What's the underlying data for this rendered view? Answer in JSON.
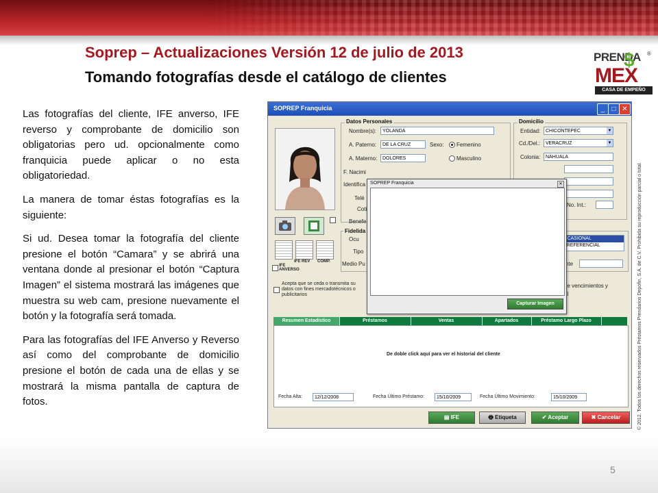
{
  "slide": {
    "title": "Soprep – Actualizaciones Versión 12 de julio de 2013",
    "subtitle": "Tomando fotografías desde el catálogo de clientes",
    "page_number": "5",
    "copyright": "© 2012. Todos los derechos reservados Préstamos Prendarios Depofin, S.A. de C.V. Prohibida su reproducción parcial o total.",
    "paragraphs": [
      "Las fotografías del cliente, IFE anverso, IFE reverso y comprobante de domicilio son obligatorias pero ud. opcionalmente como franquicia puede aplicar o no esta obligatoriedad.",
      "La manera de tomar éstas fotografías es la siguiente:",
      "Si ud.  Desea tomar la fotografía del cliente presione el botón “Camara” y se abrirá una ventana donde al presionar el botón “Captura Imagen” el sistema mostrará las imágenes que muestra su web cam, presione nuevamente el botón y la fotografía será tomada.",
      "Para las fotografías del IFE Anverso y Reverso así como del comprobante de domicilio presione el botón de cada una de ellas y se mostrará la misma pantalla de captura de fotos."
    ]
  },
  "logo": {
    "line1": "PRENDA",
    "registered": "®",
    "line2": "MEX",
    "tagline": "CASA DE EMPEÑO",
    "symbol": "$"
  },
  "colors": {
    "brand_red": "#a8171d",
    "brand_green": "#5cab2b",
    "tab_green": "#0f7a3e"
  },
  "app": {
    "window_title": "SOPREP Franquicia",
    "photo_buttons": {
      "ife_anverso": "IFE ANVERSO",
      "ife_reverso": "IFE REV",
      "comprobante": "COMP."
    },
    "datos_personales": {
      "group": "Datos Personales",
      "nombre_label": "Nombre(s):",
      "nombre": "YOLANDA",
      "paterno_label": "A. Paterno:",
      "paterno": "DE LA CRUZ",
      "materno_label": "A. Materno:",
      "materno": "DOLORES",
      "sexo_label": "Sexo:",
      "femenino": "Femenino",
      "masculino": "Masculino",
      "f_nacim_label": "F. Nacimi",
      "identif_label": "Identifica",
      "tel_label": "Telé",
      "cot_label": "Coti",
      "benef_label": "Benefe"
    },
    "domicilio": {
      "group": "Domicilio",
      "entidad_label": "Entidad:",
      "entidad": "CHICONTEPEC",
      "cd_label": "Cd./Del.:",
      "cd": "VERACRUZ",
      "colonia_label": "Colonia:",
      "colonia": "NAHUALA",
      "no_int_label": "No. Int.:"
    },
    "fidelidad": {
      "group": "Fidelida",
      "ocu_label": "Ocu",
      "tipo_label": "Tipo",
      "medio_label": "Medio Pu",
      "options": [
        "OCASIONAL",
        "PREFERENCIAL"
      ],
      "selected": "OCASIONAL",
      "cliente_label": "nte"
    },
    "consent": {
      "text": "Acepta que se ceda o transmita su datos con fines mercadotécnicos o publicitarios",
      "right_text_1": "de vencimientos y",
      "right_text_2": "al"
    },
    "tabs": [
      "Resumen Estadístico",
      "Préstamos",
      "Ventas",
      "Apartados",
      "Préstamo Largo Plazo"
    ],
    "history_hint": "De doble click aquí para ver el historial del cliente",
    "fecha_alta_label": "Fecha Alta:",
    "fecha_alta": "12/12/2008",
    "fecha_prestamo_label": "Fecha Último Préstamo:",
    "fecha_prestamo": "15/10/2009",
    "fecha_mov_label": "Fecha Último Movimiento:",
    "fecha_mov": "15/10/2009",
    "buttons": {
      "ife": "IFE",
      "etiqueta": "Etiqueta",
      "aceptar": "Aceptar",
      "cancelar": "Cancelar"
    },
    "popup": {
      "title": "SOPREP Franquicia",
      "capture_button": "Capturar Imagen"
    }
  }
}
